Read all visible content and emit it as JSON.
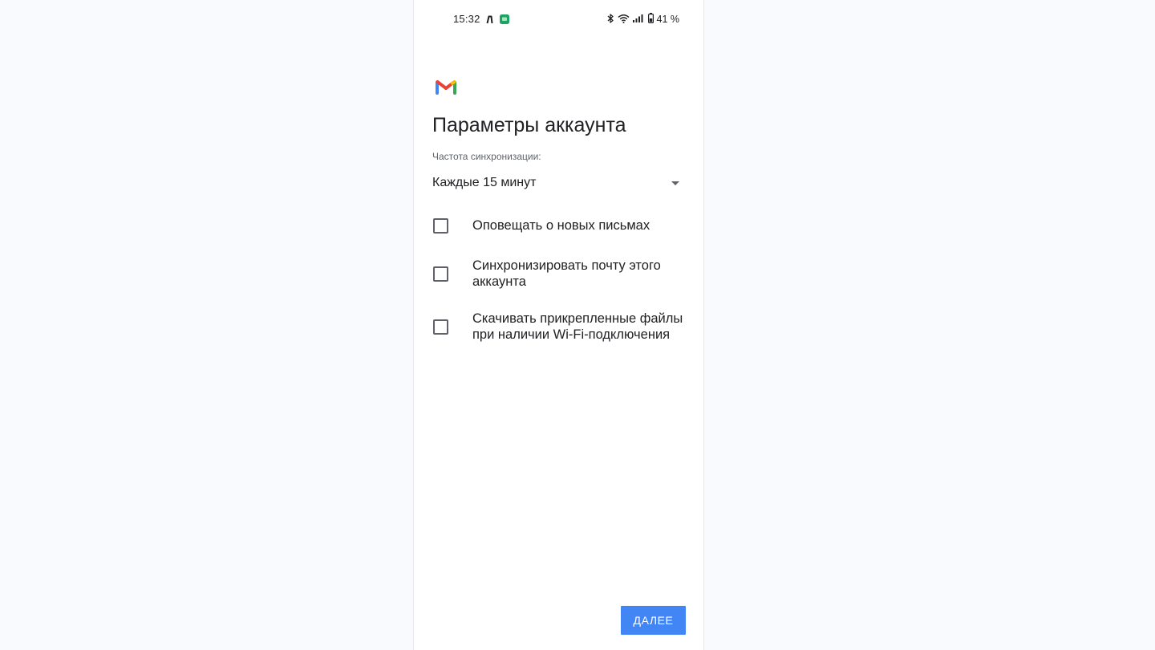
{
  "status_bar": {
    "time": "15:32",
    "battery_text": "41 %",
    "left_icons": [
      "notification-n-icon",
      "messages-app-icon"
    ],
    "right_icons": [
      "bluetooth-icon",
      "wifi-icon",
      "signal-icon",
      "battery-icon"
    ]
  },
  "app": {
    "logo": "gmail-logo",
    "colors": {
      "blue": "#4285f4",
      "red": "#ea4335",
      "yellow": "#fbbc04",
      "green": "#34a853"
    }
  },
  "screen": {
    "title": "Параметры аккаунта",
    "sync_frequency_label": "Частота синхронизации:",
    "sync_frequency_value": "Каждые 15 минут",
    "options": [
      {
        "label": "Оповещать о новых письмах",
        "checked": false
      },
      {
        "label": "Синхронизировать почту этого аккаунта",
        "checked": false
      },
      {
        "label": "Скачивать прикрепленные файлы при наличии Wi-Fi-подключения",
        "checked": false
      }
    ],
    "next_button_label": "ДАЛЕЕ"
  }
}
